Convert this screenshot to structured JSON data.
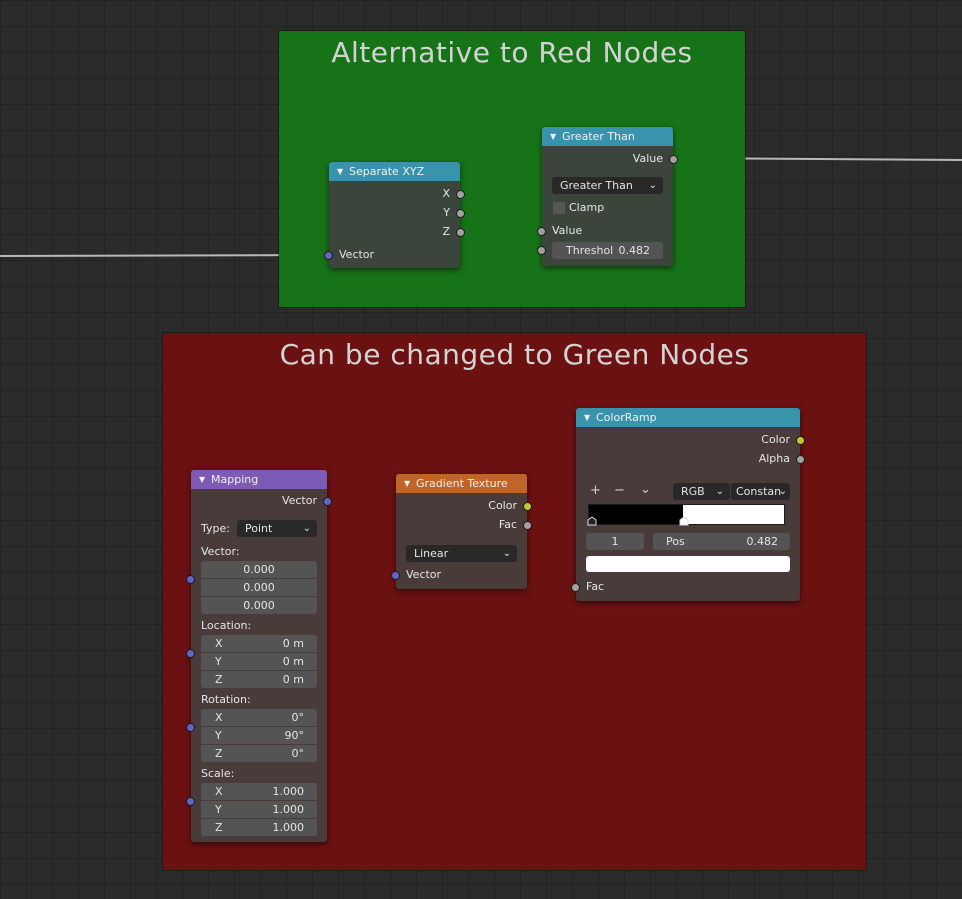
{
  "frames": {
    "green": {
      "title": "Alternative to Red Nodes",
      "color": "#177317"
    },
    "red": {
      "title": "Can be changed to Green Nodes",
      "color": "#6b1111"
    }
  },
  "separate_xyz": {
    "title": "Separate XYZ",
    "outputs": [
      "X",
      "Y",
      "Z"
    ],
    "input": "Vector",
    "header_color": "#3a93ad"
  },
  "greater_than": {
    "title": "Greater Than",
    "output": "Value",
    "operation": "Greater Than",
    "clamp_label": "Clamp",
    "input_value": "Value",
    "threshold_label": "Threshol",
    "threshold_value": "0.482",
    "header_color": "#3a93ad"
  },
  "mapping": {
    "title": "Mapping",
    "output": "Vector",
    "type_label": "Type:",
    "type_value": "Point",
    "vector_label": "Vector:",
    "vector_values": [
      "0.000",
      "0.000",
      "0.000"
    ],
    "location_label": "Location:",
    "location": [
      {
        "axis": "X",
        "value": "0 m"
      },
      {
        "axis": "Y",
        "value": "0 m"
      },
      {
        "axis": "Z",
        "value": "0 m"
      }
    ],
    "rotation_label": "Rotation:",
    "rotation": [
      {
        "axis": "X",
        "value": "0°"
      },
      {
        "axis": "Y",
        "value": "90°"
      },
      {
        "axis": "Z",
        "value": "0°"
      }
    ],
    "scale_label": "Scale:",
    "scale": [
      {
        "axis": "X",
        "value": "1.000"
      },
      {
        "axis": "Y",
        "value": "1.000"
      },
      {
        "axis": "Z",
        "value": "1.000"
      }
    ],
    "header_color": "#7d5ab5"
  },
  "gradient_texture": {
    "title": "Gradient Texture",
    "outputs": [
      "Color",
      "Fac"
    ],
    "gradient_type": "Linear",
    "input": "Vector",
    "header_color": "#c06428"
  },
  "color_ramp": {
    "title": "ColorRamp",
    "outputs": [
      "Color",
      "Alpha"
    ],
    "add_symbol": "+",
    "remove_symbol": "−",
    "menu_symbol": "⌄",
    "color_mode": "RGB",
    "interpolation": "Constan",
    "stop_index": "1",
    "pos_label": "Pos",
    "pos_value": "0.482",
    "input": "Fac",
    "header_color": "#3a93ad"
  },
  "socket_colors": {
    "float": "#a1a1a1",
    "vector": "#6363c7",
    "color": "#c7c729"
  }
}
